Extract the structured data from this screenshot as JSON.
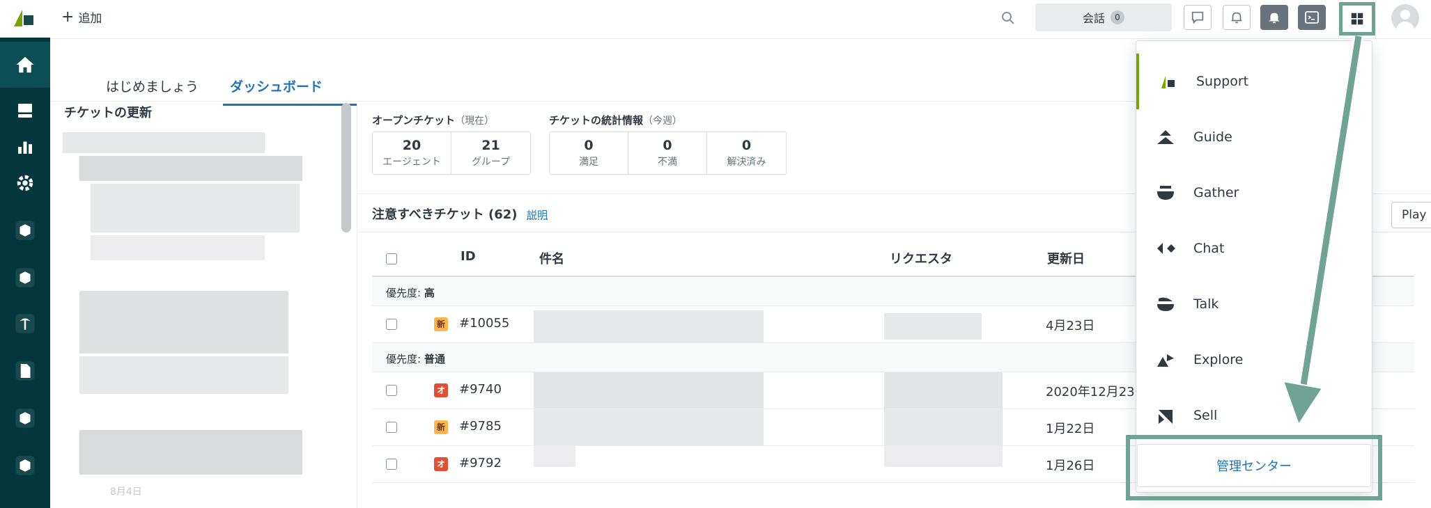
{
  "topbar": {
    "add_label": "追加",
    "conversations_label": "会話",
    "conversations_count": "0"
  },
  "tabs": [
    {
      "label": "はじめましょう"
    },
    {
      "label": "ダッシュボード"
    }
  ],
  "updates": {
    "title": "チケットの更新",
    "date": "8月4日"
  },
  "stats": {
    "open": {
      "label": "オープンチケット",
      "sub": "（現在）",
      "boxes": [
        {
          "value": "20",
          "label": "エージェント"
        },
        {
          "value": "21",
          "label": "グループ"
        }
      ]
    },
    "weekly": {
      "label": "チケットの統計情報",
      "sub": "（今週）",
      "boxes": [
        {
          "value": "0",
          "label": "満足"
        },
        {
          "value": "0",
          "label": "不満"
        },
        {
          "value": "0",
          "label": "解決済み"
        }
      ]
    }
  },
  "attention": {
    "title": "注意すべきチケット (62)",
    "link": "説明",
    "play_label": "Play"
  },
  "table": {
    "headers": {
      "id": "ID",
      "subject": "件名",
      "requester": "リクエスタ",
      "updated": "更新日"
    },
    "groups": [
      {
        "prefix": "優先度: ",
        "value": "高"
      },
      {
        "prefix": "優先度: ",
        "value": "普通"
      }
    ],
    "rows": [
      {
        "status": "新",
        "id": "#10055",
        "date": "4月23日"
      },
      {
        "status": "オ",
        "id": "#9740",
        "date": "2020年12月23"
      },
      {
        "status": "新",
        "id": "#9785",
        "date": "1月22日"
      },
      {
        "status": "オ",
        "id": "#9792",
        "date": "1月26日"
      }
    ]
  },
  "products": {
    "items": [
      {
        "label": "Support",
        "icon": "support-icon"
      },
      {
        "label": "Guide",
        "icon": "guide-icon"
      },
      {
        "label": "Gather",
        "icon": "gather-icon"
      },
      {
        "label": "Chat",
        "icon": "chat-icon"
      },
      {
        "label": "Talk",
        "icon": "talk-icon"
      },
      {
        "label": "Explore",
        "icon": "explore-icon"
      },
      {
        "label": "Sell",
        "icon": "sell-icon"
      }
    ],
    "admin_label": "管理センター"
  },
  "colors": {
    "sidebar": "#03363d",
    "brand": "#78a300",
    "accent": "#1f73b7",
    "annotation": "#6fa394",
    "status_new": "#ffb648",
    "status_open": "#e34f32"
  }
}
